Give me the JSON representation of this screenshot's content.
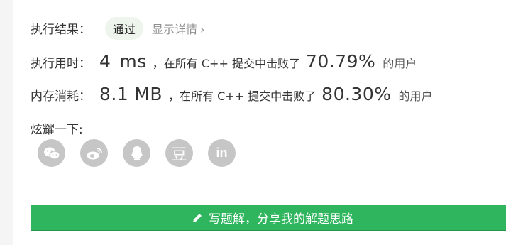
{
  "result": {
    "label": "执行结果：",
    "badge": "通过",
    "details_link": "显示详情",
    "chevron": "›"
  },
  "runtime": {
    "label": "执行用时：",
    "value": "4",
    "unit": "ms",
    "text_before": "，在所有 C++ 提交中击败了",
    "percent": "70.79%",
    "text_after": "的用户"
  },
  "memory": {
    "label": "内存消耗：",
    "value": "8.1",
    "unit": "MB",
    "text_before": "，在所有 C++ 提交中击败了",
    "percent": "80.30%",
    "text_after": "的用户"
  },
  "share": {
    "label": "炫耀一下:",
    "icons": [
      "wechat-icon",
      "weibo-icon",
      "qq-icon",
      "douban-icon",
      "linkedin-icon"
    ],
    "douban_glyph": "豆",
    "linkedin_glyph": "in"
  },
  "write_button": {
    "label": "写题解，分享我的解题思路",
    "icon": "pencil-icon"
  },
  "colors": {
    "accent_green": "#2fb55d",
    "badge_bg": "#eef5ec",
    "icon_gray": "#c6c6c6"
  }
}
